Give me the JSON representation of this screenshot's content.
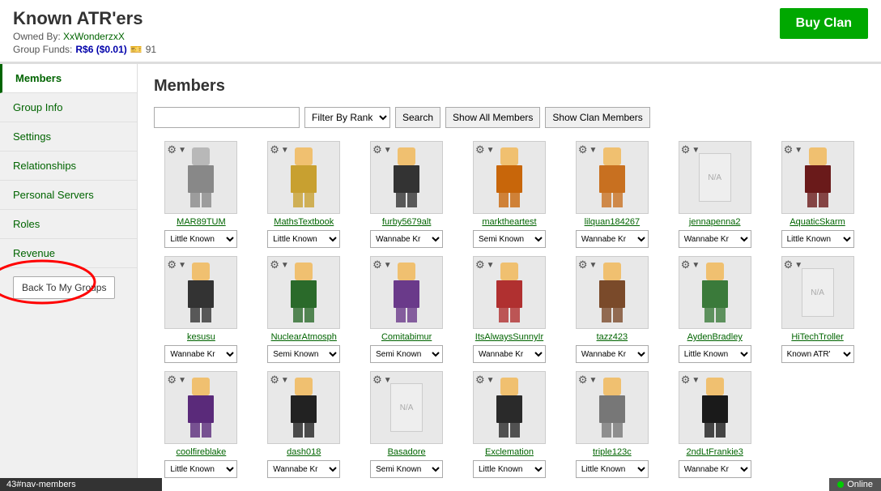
{
  "header": {
    "title": "Known ATR'ers",
    "owned_by_label": "Owned By:",
    "owner_name": "XxWonderzxX",
    "group_funds_label": "Group Funds:",
    "robux_amount": "R$6 ($0.01)",
    "ticket_amount": "91",
    "buy_clan_label": "Buy Clan"
  },
  "sidebar": {
    "items": [
      {
        "label": "Members",
        "active": true
      },
      {
        "label": "Group Info",
        "active": false
      },
      {
        "label": "Settings",
        "active": false
      },
      {
        "label": "Relationships",
        "active": false
      },
      {
        "label": "Personal Servers",
        "active": false
      },
      {
        "label": "Roles",
        "active": false
      },
      {
        "label": "Revenue",
        "active": false
      }
    ],
    "back_button_label": "Back To My Groups"
  },
  "main": {
    "title": "Members",
    "search": {
      "placeholder": "",
      "filter_default": "Filter By Rank",
      "search_btn": "Search",
      "show_all_btn": "Show All Members",
      "show_clan_btn": "Show Clan Members"
    },
    "members": [
      {
        "name": "MAR89TUM",
        "rank": "Little Known",
        "avatar_color": "gray"
      },
      {
        "name": "MathsTextbook",
        "rank": "Little Known",
        "avatar_color": "gold"
      },
      {
        "name": "furby5679alt",
        "rank": "Wannabe Kr",
        "avatar_color": "dark"
      },
      {
        "name": "marktheartest",
        "rank": "Semi Known",
        "avatar_color": "orange"
      },
      {
        "name": "lilquan184267",
        "rank": "Wannabe Kr",
        "avatar_color": "orange2"
      },
      {
        "name": "jennapenna2",
        "rank": "Wannabe Kr",
        "avatar_color": "na"
      },
      {
        "name": "AquaticSkarm",
        "rank": "Little Known",
        "avatar_color": "darkred"
      },
      {
        "name": "kesusu",
        "rank": "Wannabe Kr",
        "avatar_color": "dark"
      },
      {
        "name": "NuclearAtmosph",
        "rank": "Semi Known",
        "avatar_color": "green"
      },
      {
        "name": "Comitabimur",
        "rank": "Semi Known",
        "avatar_color": "purple"
      },
      {
        "name": "ItsAlwaysSunnyIr",
        "rank": "Wannabe Kr",
        "avatar_color": "red2"
      },
      {
        "name": "tazz423",
        "rank": "Wannabe Kr",
        "avatar_color": "brown"
      },
      {
        "name": "AydenBradley",
        "rank": "Little Known",
        "avatar_color": "green2"
      },
      {
        "name": "HiTechTroller",
        "rank": "Known ATR'",
        "avatar_color": "na"
      },
      {
        "name": "coolfireblake",
        "rank": "Little Known",
        "avatar_color": "purple2"
      },
      {
        "name": "dash018",
        "rank": "Wannabe Kr",
        "avatar_color": "dark2"
      },
      {
        "name": "Basadore",
        "rank": "Semi Known",
        "avatar_color": "na"
      },
      {
        "name": "Exclemation",
        "rank": "Little Known",
        "avatar_color": "dark3"
      },
      {
        "name": "triple123c",
        "rank": "Little Known",
        "avatar_color": "gray2"
      },
      {
        "name": "2ndLtFrankie3",
        "rank": "Wannabe Kr",
        "avatar_color": "dark4"
      }
    ],
    "rank_options": [
      "Little Known",
      "Wannabe Kr",
      "Semi Known",
      "Known ATR'",
      "Filter By Rank"
    ]
  },
  "status_bar": {
    "url_text": "43#nav-members",
    "online_label": "Online"
  }
}
